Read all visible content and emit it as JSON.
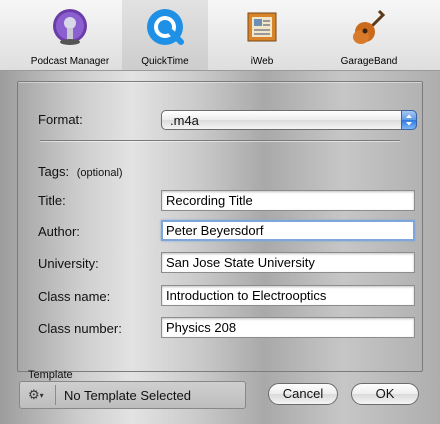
{
  "toolbar": {
    "items": [
      {
        "label": "Podcast Manager",
        "icon": "podcast-manager-icon"
      },
      {
        "label": "QuickTime",
        "icon": "quicktime-icon",
        "selected": true
      },
      {
        "label": "iWeb",
        "icon": "iweb-icon"
      },
      {
        "label": "GarageBand",
        "icon": "garageband-icon"
      }
    ]
  },
  "form": {
    "format_label": "Format:",
    "format_value": ".m4a",
    "tags_label": "Tags:",
    "tags_note": "(optional)",
    "fields": [
      {
        "label": "Title:",
        "value": "Recording Title"
      },
      {
        "label": "Author:",
        "value": "Peter Beyersdorf"
      },
      {
        "label": "University:",
        "value": "San Jose State University"
      },
      {
        "label": "Class name:",
        "value": "Introduction to Electrooptics"
      },
      {
        "label": "Class number:",
        "value": "Physics 208"
      }
    ]
  },
  "template": {
    "label": "Template",
    "value": "No Template Selected",
    "action_icon": "gear-icon"
  },
  "buttons": {
    "cancel": "Cancel",
    "ok": "OK"
  },
  "colors": {
    "focus_ring": "#7fa6d9",
    "select_arrows": "#2f78de"
  }
}
